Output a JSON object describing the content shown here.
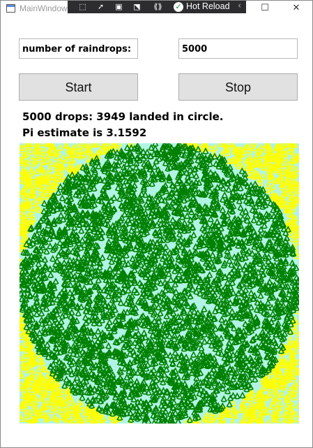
{
  "window": {
    "title": "MainWindow",
    "hot_reload_label": "Hot Reload",
    "minimize_symbol": "—",
    "maximize_symbol": "☐",
    "close_symbol": "✕"
  },
  "toolbar_icons": [
    "select-element-icon",
    "cursor-icon",
    "display-layout-icon",
    "track-focus-icon",
    "binding-icon"
  ],
  "form": {
    "raindrops_label": "number of raindrops:",
    "raindrops_value": "5000",
    "start_label": "Start",
    "stop_label": "Stop"
  },
  "result": {
    "line1": "5000 drops: 3949 landed in circle.",
    "line2": "Pi estimate is 3.1592"
  },
  "simulation": {
    "total_drops": 5000,
    "in_circle": 3949,
    "background_color": "#b2f4e4",
    "inside_color": "#008000",
    "outside_color": "#ffff00"
  }
}
